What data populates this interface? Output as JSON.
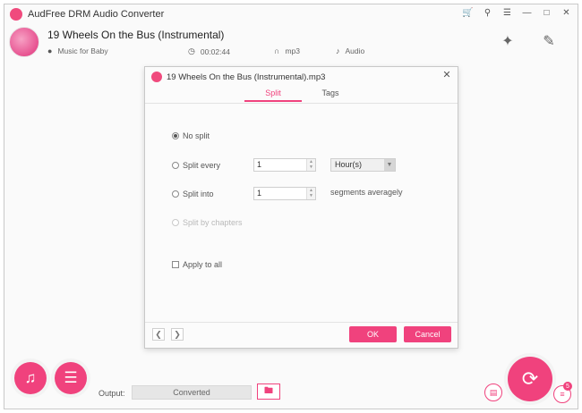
{
  "app": {
    "title": "AudFree DRM Audio Converter",
    "logo_text": "",
    "accent_color": "#f0427d"
  },
  "titlebar": {
    "icons": [
      "cart-icon",
      "key-icon",
      "menu-icon",
      "minimize-icon",
      "maximize-icon",
      "close-icon"
    ]
  },
  "track": {
    "title": "19 Wheels On the Bus (Instrumental)",
    "artist": "Music for Baby",
    "duration": "00:02:44",
    "format": "mp3",
    "type": "Audio"
  },
  "dialog": {
    "title": "19 Wheels On the Bus (Instrumental).mp3",
    "tabs": [
      {
        "label": "Split",
        "active": true
      },
      {
        "label": "Tags",
        "active": false
      }
    ],
    "options": {
      "no_split": {
        "label": "No split",
        "checked": true
      },
      "split_every": {
        "label": "Split every",
        "value": "1",
        "unit": "Hour(s)"
      },
      "split_into": {
        "label": "Split into",
        "value": "1",
        "suffix": "segments averagely"
      },
      "split_by_chapters": {
        "label": "Split by chapters",
        "disabled": true
      },
      "apply_to_all": {
        "label": "Apply to all",
        "checked": false
      }
    },
    "ok_label": "OK",
    "cancel_label": "Cancel"
  },
  "bottom": {
    "output_label": "Output:",
    "output_value": "Converted",
    "badge_count": "5"
  }
}
